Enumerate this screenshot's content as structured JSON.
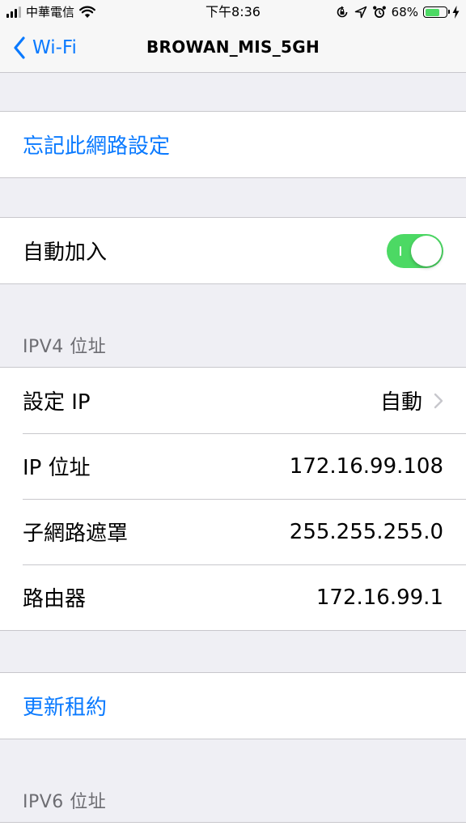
{
  "status_bar": {
    "carrier": "中華電信",
    "time": "下午8:36",
    "battery_percent": "68%",
    "battery_level": 0.68,
    "icons": [
      "signal-icon",
      "wifi-icon",
      "orientation-lock-icon",
      "location-icon",
      "alarm-icon",
      "battery-icon",
      "charging-bolt-icon"
    ]
  },
  "nav": {
    "back_label": "Wi-Fi",
    "title": "BROWAN_MIS_5GH"
  },
  "forget_network": {
    "label": "忘記此網路設定"
  },
  "auto_join": {
    "label": "自動加入",
    "enabled": true
  },
  "ipv4": {
    "header": "IPV4 位址",
    "rows": [
      {
        "label": "設定 IP",
        "value": "自動"
      },
      {
        "label": "IP 位址",
        "value": "172.16.99.108"
      },
      {
        "label": "子網路遮罩",
        "value": "255.255.255.0"
      },
      {
        "label": "路由器",
        "value": "172.16.99.1"
      }
    ]
  },
  "renew_lease": {
    "label": "更新租約"
  },
  "ipv6": {
    "header": "IPV6 位址"
  },
  "colors": {
    "accent": "#0a7aff",
    "toggle_on": "#4cd964",
    "background": "#efeff4",
    "separator": "#c8c7cc",
    "section_header": "#6d6d72"
  }
}
